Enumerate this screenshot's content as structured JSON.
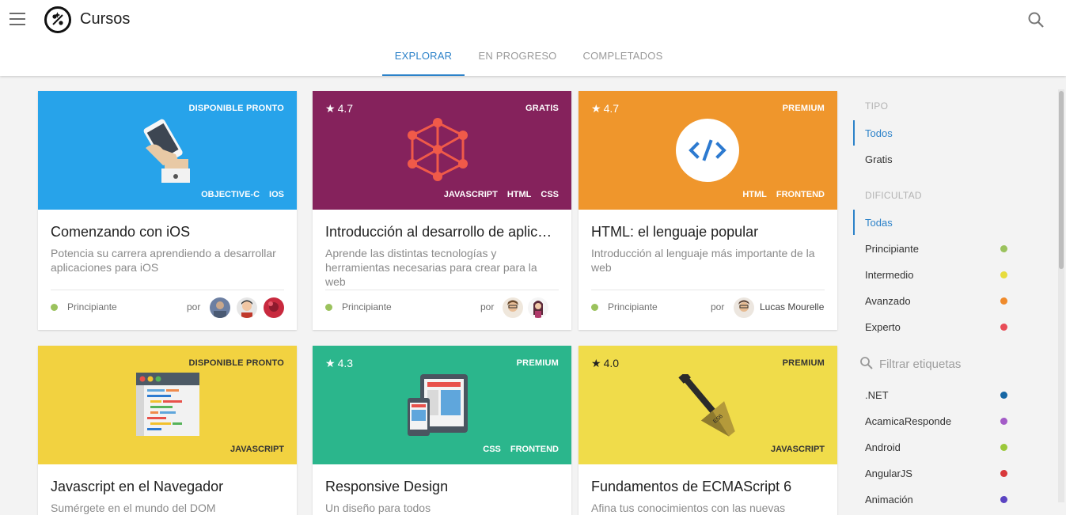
{
  "header": {
    "title": "Cursos"
  },
  "tabs": [
    {
      "label": "EXPLORAR"
    },
    {
      "label": "EN PROGRESO"
    },
    {
      "label": "COMPLETADOS"
    }
  ],
  "cards": [
    {
      "badge": "DISPONIBLE PRONTO",
      "rating": "",
      "tags": [
        "OBJECTIVE-C",
        "IOS"
      ],
      "title": "Comenzando con iOS",
      "description": "Potencia su carrera aprendiendo a desarrollar aplicaciones para iOS",
      "level": "Principiante",
      "by": "por",
      "author": "",
      "color": "#27a3ea"
    },
    {
      "badge": "GRATIS",
      "rating": "4.7",
      "tags": [
        "JAVASCRIPT",
        "HTML",
        "CSS"
      ],
      "title": "Introducción al desarrollo de aplic…",
      "description": "Aprende las distintas tecnologías y herramientas necesarias para crear para la web",
      "level": "Principiante",
      "by": "por",
      "author": "",
      "color": "#85225c"
    },
    {
      "badge": "PREMIUM",
      "rating": "4.7",
      "tags": [
        "HTML",
        "FRONTEND"
      ],
      "title": "HTML: el lenguaje popular",
      "description": "Introducción al lenguaje más importante de la web",
      "level": "Principiante",
      "by": "por",
      "author": "Lucas Mourelle",
      "color": "#ef962c"
    },
    {
      "badge": "DISPONIBLE PRONTO",
      "rating": "",
      "tags": [
        "JAVASCRIPT"
      ],
      "title": "Javascript en el Navegador",
      "description": "Sumérgete en el mundo del DOM",
      "color": "#f2d240"
    },
    {
      "badge": "PREMIUM",
      "rating": "4.3",
      "tags": [
        "CSS",
        "FRONTEND"
      ],
      "title": "Responsive Design",
      "description": "Un diseño para todos",
      "color": "#2bb68c"
    },
    {
      "badge": "PREMIUM",
      "rating": "4.0",
      "tags": [
        "JAVASCRIPT"
      ],
      "title": "Fundamentos de ECMAScript 6",
      "description": "Afina tus conocimientos con las nuevas",
      "color": "#f0dc4a"
    }
  ],
  "sidebar": {
    "tipo_heading": "TIPO",
    "tipo": [
      {
        "label": "Todos",
        "active": true
      },
      {
        "label": "Gratis"
      }
    ],
    "dificultad_heading": "DIFICULTAD",
    "dificultad": [
      {
        "label": "Todas",
        "active": true
      },
      {
        "label": "Principiante",
        "color": "#9bc25d"
      },
      {
        "label": "Intermedio",
        "color": "#e7dc3d"
      },
      {
        "label": "Avanzado",
        "color": "#ef8a2b"
      },
      {
        "label": "Experto",
        "color": "#e84c57"
      }
    ],
    "filter_placeholder": "Filtrar etiquetas",
    "tags": [
      {
        "label": ".NET",
        "color": "#1666a4"
      },
      {
        "label": "AcamicaResponde",
        "color": "#a35bc7"
      },
      {
        "label": "Android",
        "color": "#9bc83a"
      },
      {
        "label": "AngularJS",
        "color": "#d8383a"
      },
      {
        "label": "Animación",
        "color": "#5b44c2"
      }
    ]
  },
  "icons": {
    "menu": "hamburger-menu-icon",
    "logo": "acamica-logo-icon",
    "search": "search-icon",
    "star": "star-icon"
  }
}
